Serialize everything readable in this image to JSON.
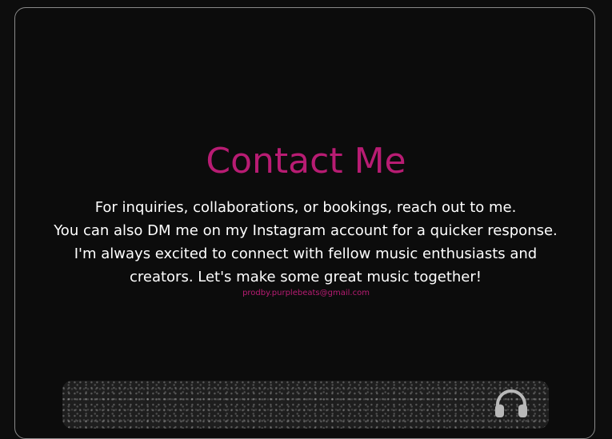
{
  "contact": {
    "title": "Contact Me",
    "line1": "For inquiries, collaborations, or bookings, reach out to me.",
    "line2": "You can also DM me on my Instagram account for a quicker response. I'm always excited to connect with fellow music enthusiasts and creators. Let's make some great music together!",
    "email": "prodby.purplebeats@gmail.com"
  },
  "icons": {
    "banner_icon": "headphones-icon"
  },
  "colors": {
    "accent": "#b81c73",
    "text": "#ffffff",
    "background": "#0c0c0c"
  }
}
